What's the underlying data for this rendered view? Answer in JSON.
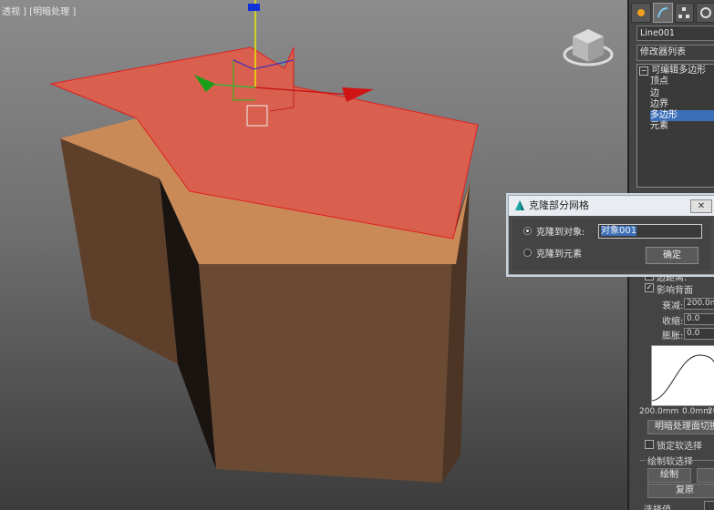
{
  "viewport": {
    "label": "透视 ] [明暗处理 ]"
  },
  "colors": {
    "selected_face": "#d9604f",
    "side_face_light": "#c98a58",
    "side_face_dark": "#5a3e2b",
    "selection_blue": "#3d6fb8"
  },
  "panel": {
    "tabs": [
      "create-icon",
      "modify-icon",
      "hierarchy-icon",
      "motion-icon"
    ],
    "object_name": "Line001",
    "modifier_list": "修改器列表",
    "stack": {
      "root": "可编辑多边形",
      "items": [
        "顶点",
        "边",
        "边界",
        "多边形",
        "元素"
      ],
      "selected": "多边形"
    },
    "soft_selection": {
      "edge_distance": "边距离:",
      "affect_backfacing": "影响背面",
      "falloff_label": "衰减:",
      "falloff_value": "200.0mm",
      "pinch_label": "收缩:",
      "pinch_value": "0.0",
      "bubble_label": "膨胀:",
      "bubble_value": "0.0",
      "curve_left": "200.0mm",
      "curve_mid": "0.0mm",
      "curve_right": "200",
      "shaded_face_toggle": "明暗处理面切换",
      "lock_soft": "锁定软选择",
      "paint_group": "绘制软选择",
      "paint_btn": "绘制",
      "revert_btn": "复原",
      "select_value": "选择值"
    }
  },
  "dialog": {
    "title": "克隆部分网格",
    "close": "✕",
    "option_object": "克隆到对象:",
    "object_name": "对象001",
    "option_element": "克隆到元素",
    "ok": "确定"
  }
}
